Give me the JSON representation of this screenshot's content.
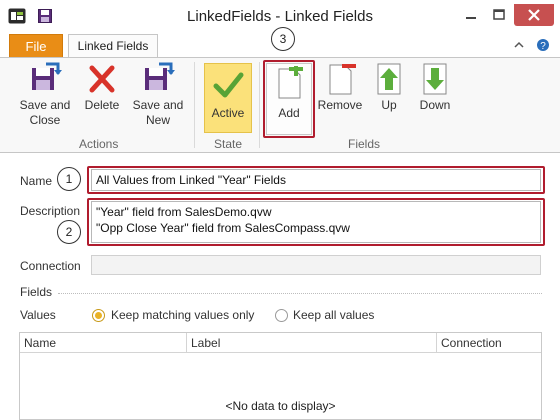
{
  "window": {
    "title": "LinkedFields - Linked Fields"
  },
  "tabs": {
    "file": "File",
    "linked_fields": "Linked Fields"
  },
  "ribbon": {
    "actions": {
      "save_and_close": "Save and\nClose",
      "delete": "Delete",
      "save_and_new": "Save and\nNew",
      "group_label": "Actions"
    },
    "state": {
      "active": "Active",
      "group_label": "State"
    },
    "fields": {
      "add": "Add",
      "remove": "Remove",
      "up": "Up",
      "down": "Down",
      "group_label": "Fields"
    }
  },
  "form": {
    "name_label": "Name",
    "name_value": "All Values from Linked \"Year\" Fields",
    "description_label": "Description",
    "description_line1": "\"Year\" field from SalesDemo.qvw",
    "description_line2": "\"Opp Close Year\" field from SalesCompass.qvw",
    "connection_label": "Connection",
    "connection_value": "",
    "fields_section": "Fields",
    "values_label": "Values",
    "values_options": [
      {
        "label": "Keep matching values only",
        "selected": true
      },
      {
        "label": "Keep all values",
        "selected": false
      }
    ],
    "grid": {
      "columns": [
        "Name",
        "Label",
        "Connection"
      ],
      "empty_text": "<No data to display>"
    }
  },
  "callouts": [
    "1",
    "2",
    "3"
  ],
  "colors": {
    "file_tab": "#e98d16",
    "active_button": "#fbe17a",
    "highlight": "#b01c2e",
    "close_button": "#c75050"
  }
}
